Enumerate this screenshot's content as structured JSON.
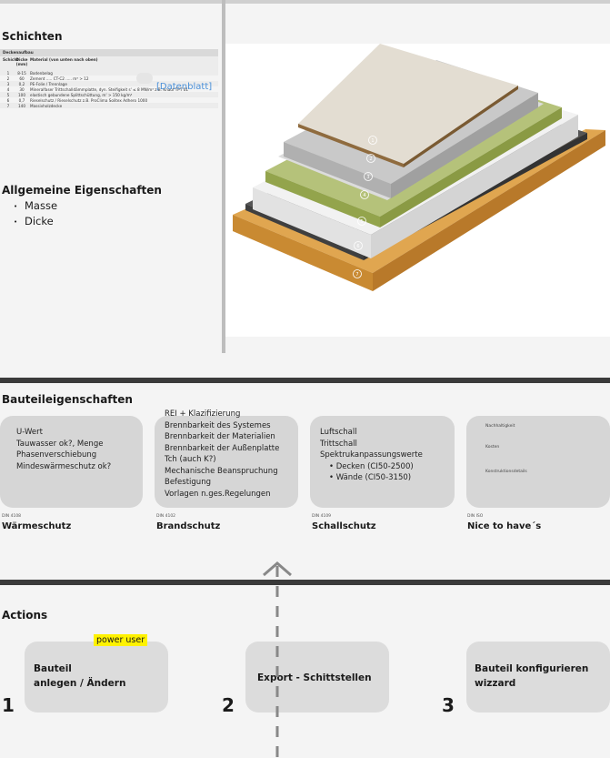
{
  "schichten": {
    "title": "Schichten",
    "datasheet": {
      "header": "Deckenaufbau",
      "columns": [
        "Schicht",
        "Dicke (mm)",
        "Material (von unten nach oben)"
      ],
      "rows": [
        [
          "1",
          "8-15",
          "Bodenbelag"
        ],
        [
          "2",
          "60",
          "Zement  ..... CT-C2  ..... m³ > 12"
        ],
        [
          "3",
          "0,2",
          "PE-Folie / Trennlage"
        ],
        [
          "4",
          "30",
          "Mineralfaser Trittschalldämmplatte, dyn. Steifigkeit s' ≤ 8 MN/m³ z.B. Knauf TPT 01"
        ],
        [
          "5",
          "100",
          "elastisch gebundene Splittschüttung, m' > 150 kg/m³"
        ],
        [
          "6",
          "0,7",
          "Rieselschutz / Rieselschutz z.B. ProClima Solitex Adhero 1000"
        ],
        [
          "7",
          "140",
          "Massivholzdecke"
        ]
      ],
      "link": "[Datenblatt]"
    }
  },
  "allgemeine": {
    "title": "Allgemeine Eigenschaften",
    "items": [
      "Masse",
      "Dicke"
    ]
  },
  "bauteil": {
    "title": "Bauteileigenschaften",
    "cards": [
      {
        "items": [
          "U-Wert",
          "Tauwasser ok?, Menge",
          "Phasenverschiebung",
          "Mindeswärmeschutz ok?"
        ],
        "small": "DIN 4108",
        "label": "Wärmeschutz"
      },
      {
        "items": [
          "REI + Klazifizierung",
          "Brennbarkeit des Systemes",
          "Brennbarkeit der Materialien",
          "Brennbarkeit der Außenplatte",
          "Tch (auch K?)",
          "Mechanische Beanspruchung",
          "Befestigung",
          "Vorlagen n.ges.Regelungen"
        ],
        "small": "DIN 4102",
        "label": "Brandschutz"
      },
      {
        "items": [
          "Luftschall",
          "Trittschall",
          "Spektrukanpassungswerte"
        ],
        "subitems": [
          "Decken (CI50-2500)",
          "Wände (CI50-3150)"
        ],
        "small": "DIN 4109",
        "label": "Schallschutz"
      },
      {
        "items": [
          "Nachhaltigkeit",
          "Kosten",
          "Konstruktionsdetails"
        ],
        "small": "DIN ISO",
        "label": "Nice to have´s"
      }
    ]
  },
  "actions": {
    "title": "Actions",
    "badge": "power user",
    "items": [
      {
        "number": "1",
        "line1": "Bauteil",
        "line2": "anlegen / Ändern"
      },
      {
        "number": "2",
        "line1": "Export - Schittstellen",
        "line2": ""
      },
      {
        "number": "3",
        "line1": "Bauteil konfigurieren",
        "line2": "wizzard"
      }
    ]
  },
  "layers": [
    "1",
    "2",
    "3",
    "4",
    "5",
    "6",
    "7"
  ]
}
